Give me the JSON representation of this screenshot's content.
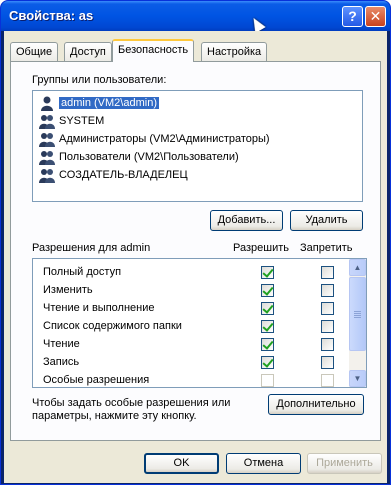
{
  "window": {
    "title": "Свойства: as",
    "help_glyph": "?",
    "close_glyph": "✕"
  },
  "tabs": [
    "Общие",
    "Доступ",
    "Безопасность",
    "Настройка"
  ],
  "groups": {
    "label": "Группы или пользователи:",
    "items": [
      "admin (VM2\\admin)",
      "SYSTEM",
      "Администраторы (VM2\\Администраторы)",
      "Пользователи (VM2\\Пользователи)",
      "СОЗДАТЕЛЬ-ВЛАДЕЛЕЦ"
    ],
    "add_button": "Добавить...",
    "remove_button": "Удалить"
  },
  "permissions": {
    "label": "Разрешения для admin",
    "allow_header": "Разрешить",
    "deny_header": "Запретить",
    "rows": [
      {
        "name": "Полный доступ",
        "allow": true,
        "deny": false
      },
      {
        "name": "Изменить",
        "allow": true,
        "deny": false
      },
      {
        "name": "Чтение и выполнение",
        "allow": true,
        "deny": false
      },
      {
        "name": "Список содержимого папки",
        "allow": true,
        "deny": false
      },
      {
        "name": "Чтение",
        "allow": true,
        "deny": false
      },
      {
        "name": "Запись",
        "allow": true,
        "deny": false
      },
      {
        "name": "Особые разрешения",
        "allow": false,
        "deny": false
      }
    ]
  },
  "special": {
    "text_line1": "Чтобы задать особые разрешения или",
    "text_line2": "параметры, нажмите эту кнопку.",
    "advanced_button": "Дополнительно"
  },
  "footer": {
    "ok": "OK",
    "cancel": "Отмена",
    "apply": "Применить"
  }
}
